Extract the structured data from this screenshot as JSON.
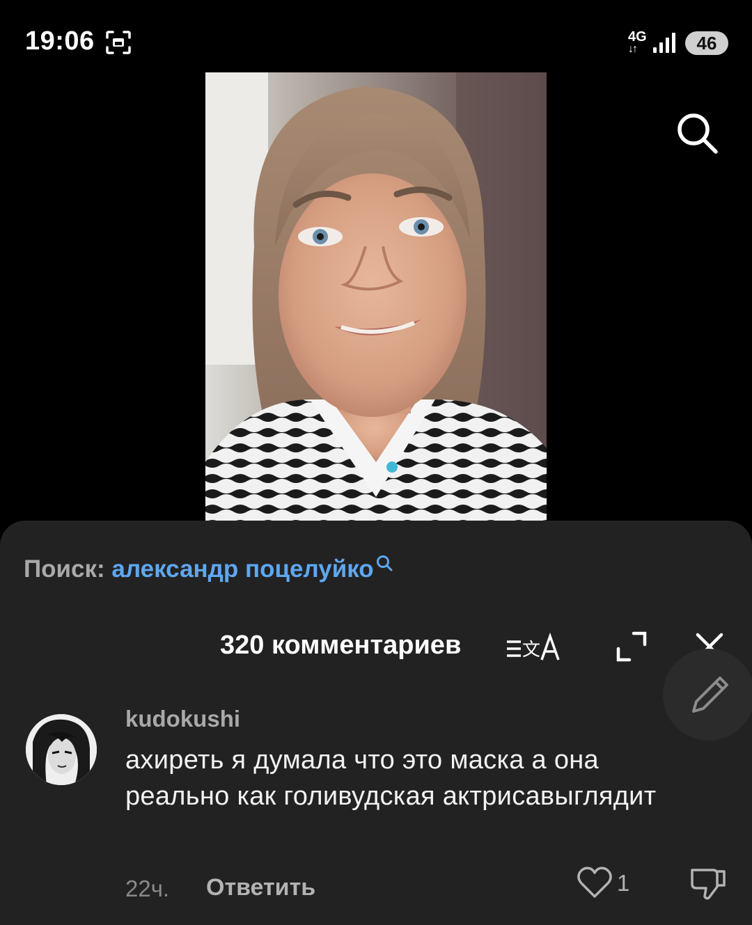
{
  "status_bar": {
    "time": "19:06",
    "network": "4G",
    "battery": "46",
    "icons": [
      "screenshot-icon",
      "signal-icon",
      "battery-icon"
    ]
  },
  "video": {
    "content": "selfie video frame",
    "top_right_icon": "search-icon"
  },
  "comments": {
    "search_label": "Поиск: ",
    "search_query": "александр поцелуйко",
    "title": "320 комментариев",
    "icons": [
      "translate-icon",
      "expand-icon",
      "close-icon",
      "pencil-icon"
    ],
    "items": [
      {
        "username": "kudokushi",
        "text": "ахиреть я думала что это маска а она реально как голивудская актрисавыглядит",
        "time": "22ч.",
        "reply_label": "Ответить",
        "likes": "1"
      }
    ]
  },
  "colors": {
    "sheet_bg": "#222222",
    "accent_link": "#5ea7f0",
    "muted_text": "#a9a9a9"
  }
}
